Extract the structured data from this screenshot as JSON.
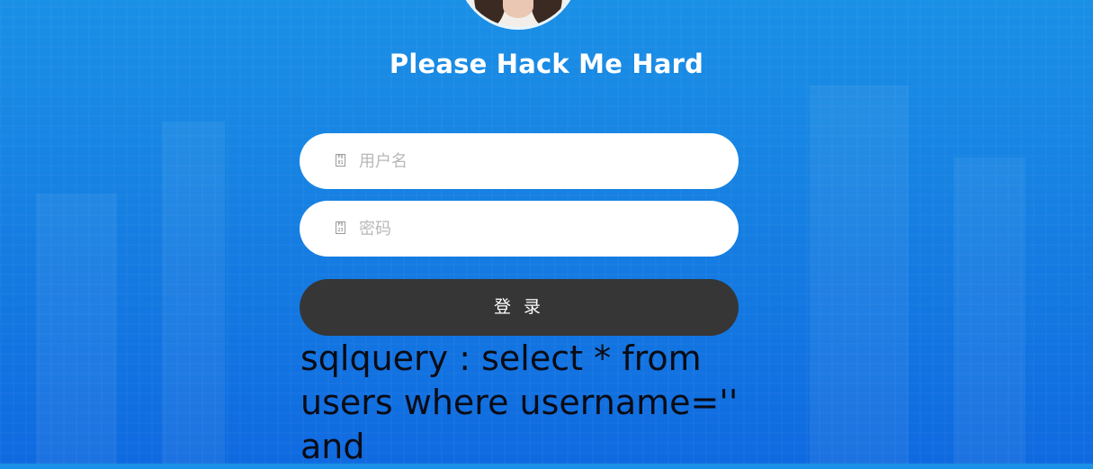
{
  "header": {
    "title": "Please Hack Me Hard"
  },
  "form": {
    "username": {
      "placeholder": "用户名",
      "value": "",
      "icon": "user-icon"
    },
    "password": {
      "placeholder": "密码",
      "value": "",
      "icon": "lock-icon"
    },
    "login_label": "登 录"
  },
  "debug": {
    "sqlquery": "sqlquery : select * from users where username='' and"
  },
  "colors": {
    "background": "#1680e2",
    "button": "#363636",
    "field": "#ffffff",
    "title": "#ffffff",
    "sql_text": "#0b0b14"
  }
}
